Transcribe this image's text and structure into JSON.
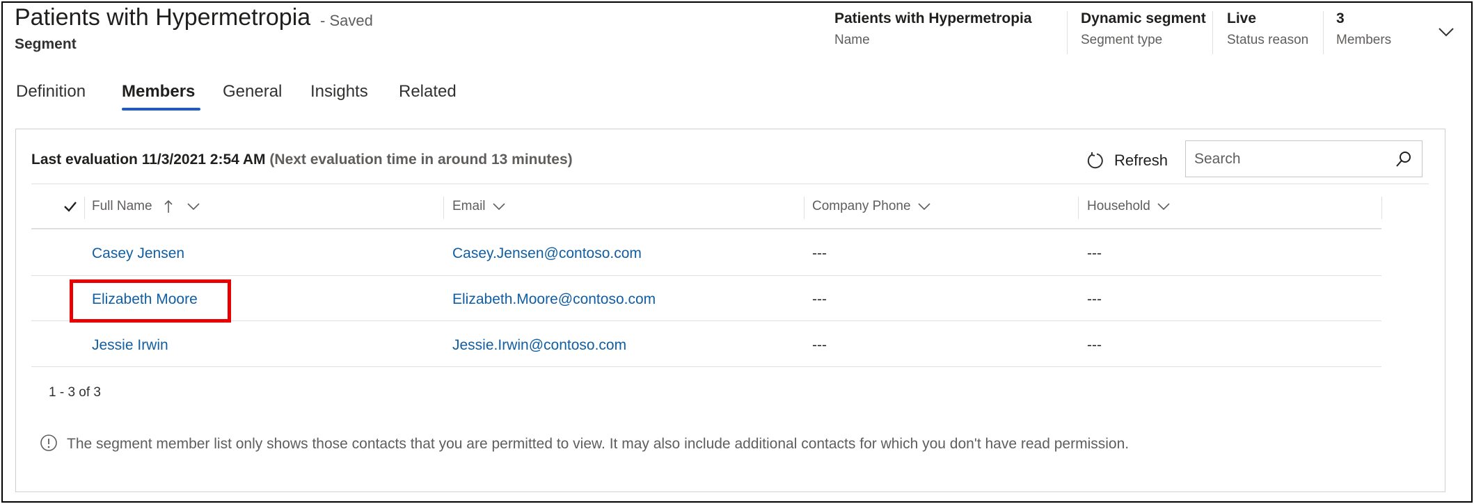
{
  "header": {
    "title": "Patients with Hypermetropia",
    "save_status": "- Saved",
    "entity": "Segment"
  },
  "summary": [
    {
      "value": "Patients with Hypermetropia",
      "label": "Name"
    },
    {
      "value": "Dynamic segment",
      "label": "Segment type"
    },
    {
      "value": "Live",
      "label": "Status reason"
    },
    {
      "value": "3",
      "label": "Members"
    }
  ],
  "tabs": [
    {
      "label": "Definition",
      "active": false
    },
    {
      "label": "Members",
      "active": true
    },
    {
      "label": "General",
      "active": false
    },
    {
      "label": "Insights",
      "active": false
    },
    {
      "label": "Related",
      "active": false
    }
  ],
  "members": {
    "last_evaluation": "Last evaluation 11/3/2021 2:54 AM",
    "next_evaluation": "(Next evaluation time in around 13 minutes)",
    "refresh_label": "Refresh",
    "search_placeholder": "Search",
    "columns": [
      "Full Name",
      "Email",
      "Company Phone",
      "Household"
    ],
    "rows": [
      {
        "name": "Casey Jensen",
        "email": "Casey.Jensen@contoso.com",
        "phone": "---",
        "household": "---"
      },
      {
        "name": "Elizabeth Moore",
        "email": "Elizabeth.Moore@contoso.com",
        "phone": "---",
        "household": "---"
      },
      {
        "name": "Jessie Irwin",
        "email": "Jessie.Irwin@contoso.com",
        "phone": "---",
        "household": "---"
      }
    ],
    "pager": "1 - 3 of 3",
    "notice": "The segment member list only shows those contacts that you are permitted to view. It may also include additional contacts for which you don't have read permission."
  },
  "colors": {
    "link": "#115ea3",
    "tab_underline": "#1e5ac8",
    "highlight": "#e80000"
  },
  "icons": {
    "expand": "chevron-down-icon",
    "refresh": "refresh-icon",
    "search": "search-icon",
    "select_all": "checkmark-icon",
    "sort": "sort-ascending-icon",
    "info": "info-icon"
  }
}
